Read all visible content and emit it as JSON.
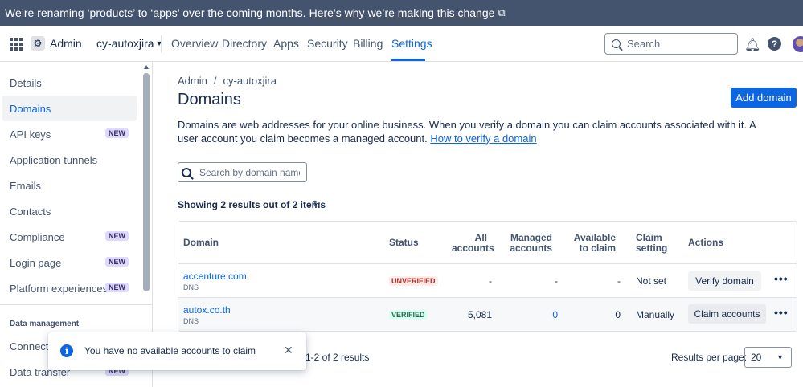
{
  "banner": {
    "text": "We’re renaming ‘products’ to ‘apps’ over the coming months.",
    "link": "Here’s why we’re making this change"
  },
  "topnav": {
    "admin_label": "Admin",
    "org_name": "cy-autoxjira",
    "tabs": [
      "Overview",
      "Directory",
      "Apps",
      "Security",
      "Billing",
      "Settings"
    ],
    "active_tab": "Settings",
    "search_placeholder": "Search",
    "help_glyph": "?"
  },
  "sidebar": {
    "items": [
      {
        "label": "Details"
      },
      {
        "label": "Domains"
      },
      {
        "label": "API keys",
        "badge": "NEW"
      },
      {
        "label": "Application tunnels"
      },
      {
        "label": "Emails"
      },
      {
        "label": "Contacts"
      },
      {
        "label": "Compliance",
        "badge": "NEW"
      },
      {
        "label": "Login page",
        "badge": "NEW"
      },
      {
        "label": "Platform experiences",
        "badge": "NEW"
      }
    ],
    "section_heading": "Data management",
    "section_items": [
      {
        "label": "Connected apps"
      },
      {
        "label": "Data transfer",
        "badge": "NEW"
      }
    ]
  },
  "main": {
    "breadcrumb": [
      "Admin",
      "cy-autoxjira"
    ],
    "title": "Domains",
    "add_button": "Add domain",
    "description": "Domains are web addresses for your online business. When you verify a domain you can claim accounts associated with it. A user account you claim becomes a managed account.",
    "description_link": "How to verify a domain",
    "search_placeholder": "Search by domain name",
    "showing": "Showing 2 results out of 2 items"
  },
  "table": {
    "headers": {
      "domain": "Domain",
      "status": "Status",
      "all_accounts": [
        "All",
        "accounts"
      ],
      "managed_accounts": [
        "Managed",
        "accounts"
      ],
      "available": [
        "Available",
        "to claim"
      ],
      "claim_setting": [
        "Claim",
        "setting"
      ],
      "actions": "Actions"
    },
    "rows": [
      {
        "domain": "accenture.com",
        "type": "DNS",
        "status": "UNVERIFIED",
        "all_accounts": "-",
        "managed": "-",
        "available": "-",
        "claim_setting": "Not set",
        "action": "Verify domain"
      },
      {
        "domain": "autox.co.th",
        "type": "DNS",
        "status": "VERIFIED",
        "all_accounts": "5,081",
        "managed": "0",
        "available": "0",
        "claim_setting": "Manually",
        "action": "Claim accounts"
      }
    ]
  },
  "pagination": {
    "range": "1-2 of 2 results",
    "rpp_label": "Results per page:",
    "rpp_value": "20"
  },
  "toast": {
    "message": "You have no available accounts to claim"
  },
  "colors": {
    "accent": "#0c66e4",
    "banner_bg": "#44546f",
    "unverified": "#ae2e24",
    "verified": "#216e4e"
  }
}
